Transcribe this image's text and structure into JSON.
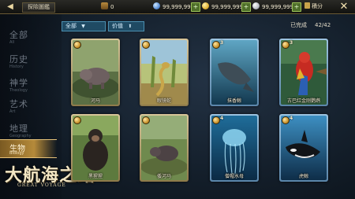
{
  "topbar": {
    "back_label": "◀",
    "breadcrumb": "探險圖鑑",
    "chest_count": "0",
    "gems": "99,999,999",
    "gold": "99,999,999",
    "silver": "99,999,999",
    "score_label": "積分",
    "close_label": "✕",
    "plus_label": "+"
  },
  "nav": {
    "items": [
      {
        "zh": "全部",
        "en": "All"
      },
      {
        "zh": "历史",
        "en": "History"
      },
      {
        "zh": "神学",
        "en": "Theology"
      },
      {
        "zh": "艺术",
        "en": "Art"
      },
      {
        "zh": "地理",
        "en": "Geography"
      }
    ],
    "active": {
      "zh": "生物",
      "en": "Biology"
    }
  },
  "logo": {
    "zh": "大航海之路",
    "en": "GREAT VOYAGE"
  },
  "filters": {
    "category_label": "全部",
    "sort_label": "价值"
  },
  "progress": {
    "label": "已完成",
    "count": "42/42"
  },
  "cards": [
    {
      "name": "河马",
      "stars": "",
      "frame": "gold"
    },
    {
      "name": "眼镜蛇",
      "stars": "",
      "frame": "gold"
    },
    {
      "name": "抹香鲸",
      "stars": "3",
      "frame": "blue"
    },
    {
      "name": "古巴红金刚鹦鹉",
      "stars": "3",
      "frame": "blue"
    },
    {
      "name": "黑猩猩",
      "stars": "",
      "frame": "gold"
    },
    {
      "name": "倭河马",
      "stars": "",
      "frame": "gold"
    },
    {
      "name": "僧帽水母",
      "stars": "4",
      "frame": "blue"
    },
    {
      "name": "虎鲸",
      "stars": "4",
      "frame": "blue"
    }
  ],
  "colors": {
    "gold_frame": "#c9b27c",
    "blue_frame": "#7ea7c9",
    "accent": "#b58a3a"
  }
}
